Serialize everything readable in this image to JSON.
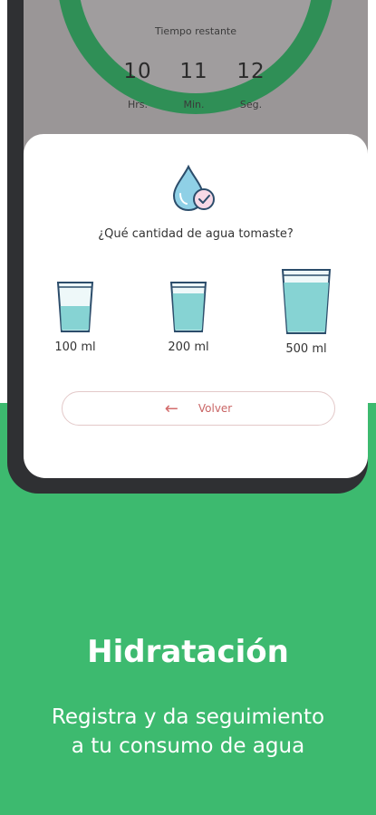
{
  "timer": {
    "label": "Tiempo restante",
    "hours": "10",
    "hours_unit": "Hrs.",
    "minutes": "11",
    "minutes_unit": "Min.",
    "seconds": "12",
    "seconds_unit": "Seg."
  },
  "dialog": {
    "icon": "water-drop-check-icon",
    "question": "¿Qué cantidad de agua tomaste?",
    "options": [
      {
        "label": "100 ml",
        "icon": "small-glass-icon"
      },
      {
        "label": "200 ml",
        "icon": "medium-glass-icon"
      },
      {
        "label": "500 ml",
        "icon": "large-glass-icon"
      }
    ],
    "back_label": "Volver",
    "back_icon": "arrow-left-icon"
  },
  "promo": {
    "title": "Hidratación",
    "subtitle_line1": "Registra y da seguimiento",
    "subtitle_line2": "a tu consumo de agua"
  },
  "colors": {
    "brand_green": "#3dba6f",
    "water": "#86d3d3",
    "accent_red": "#d36b6b"
  }
}
